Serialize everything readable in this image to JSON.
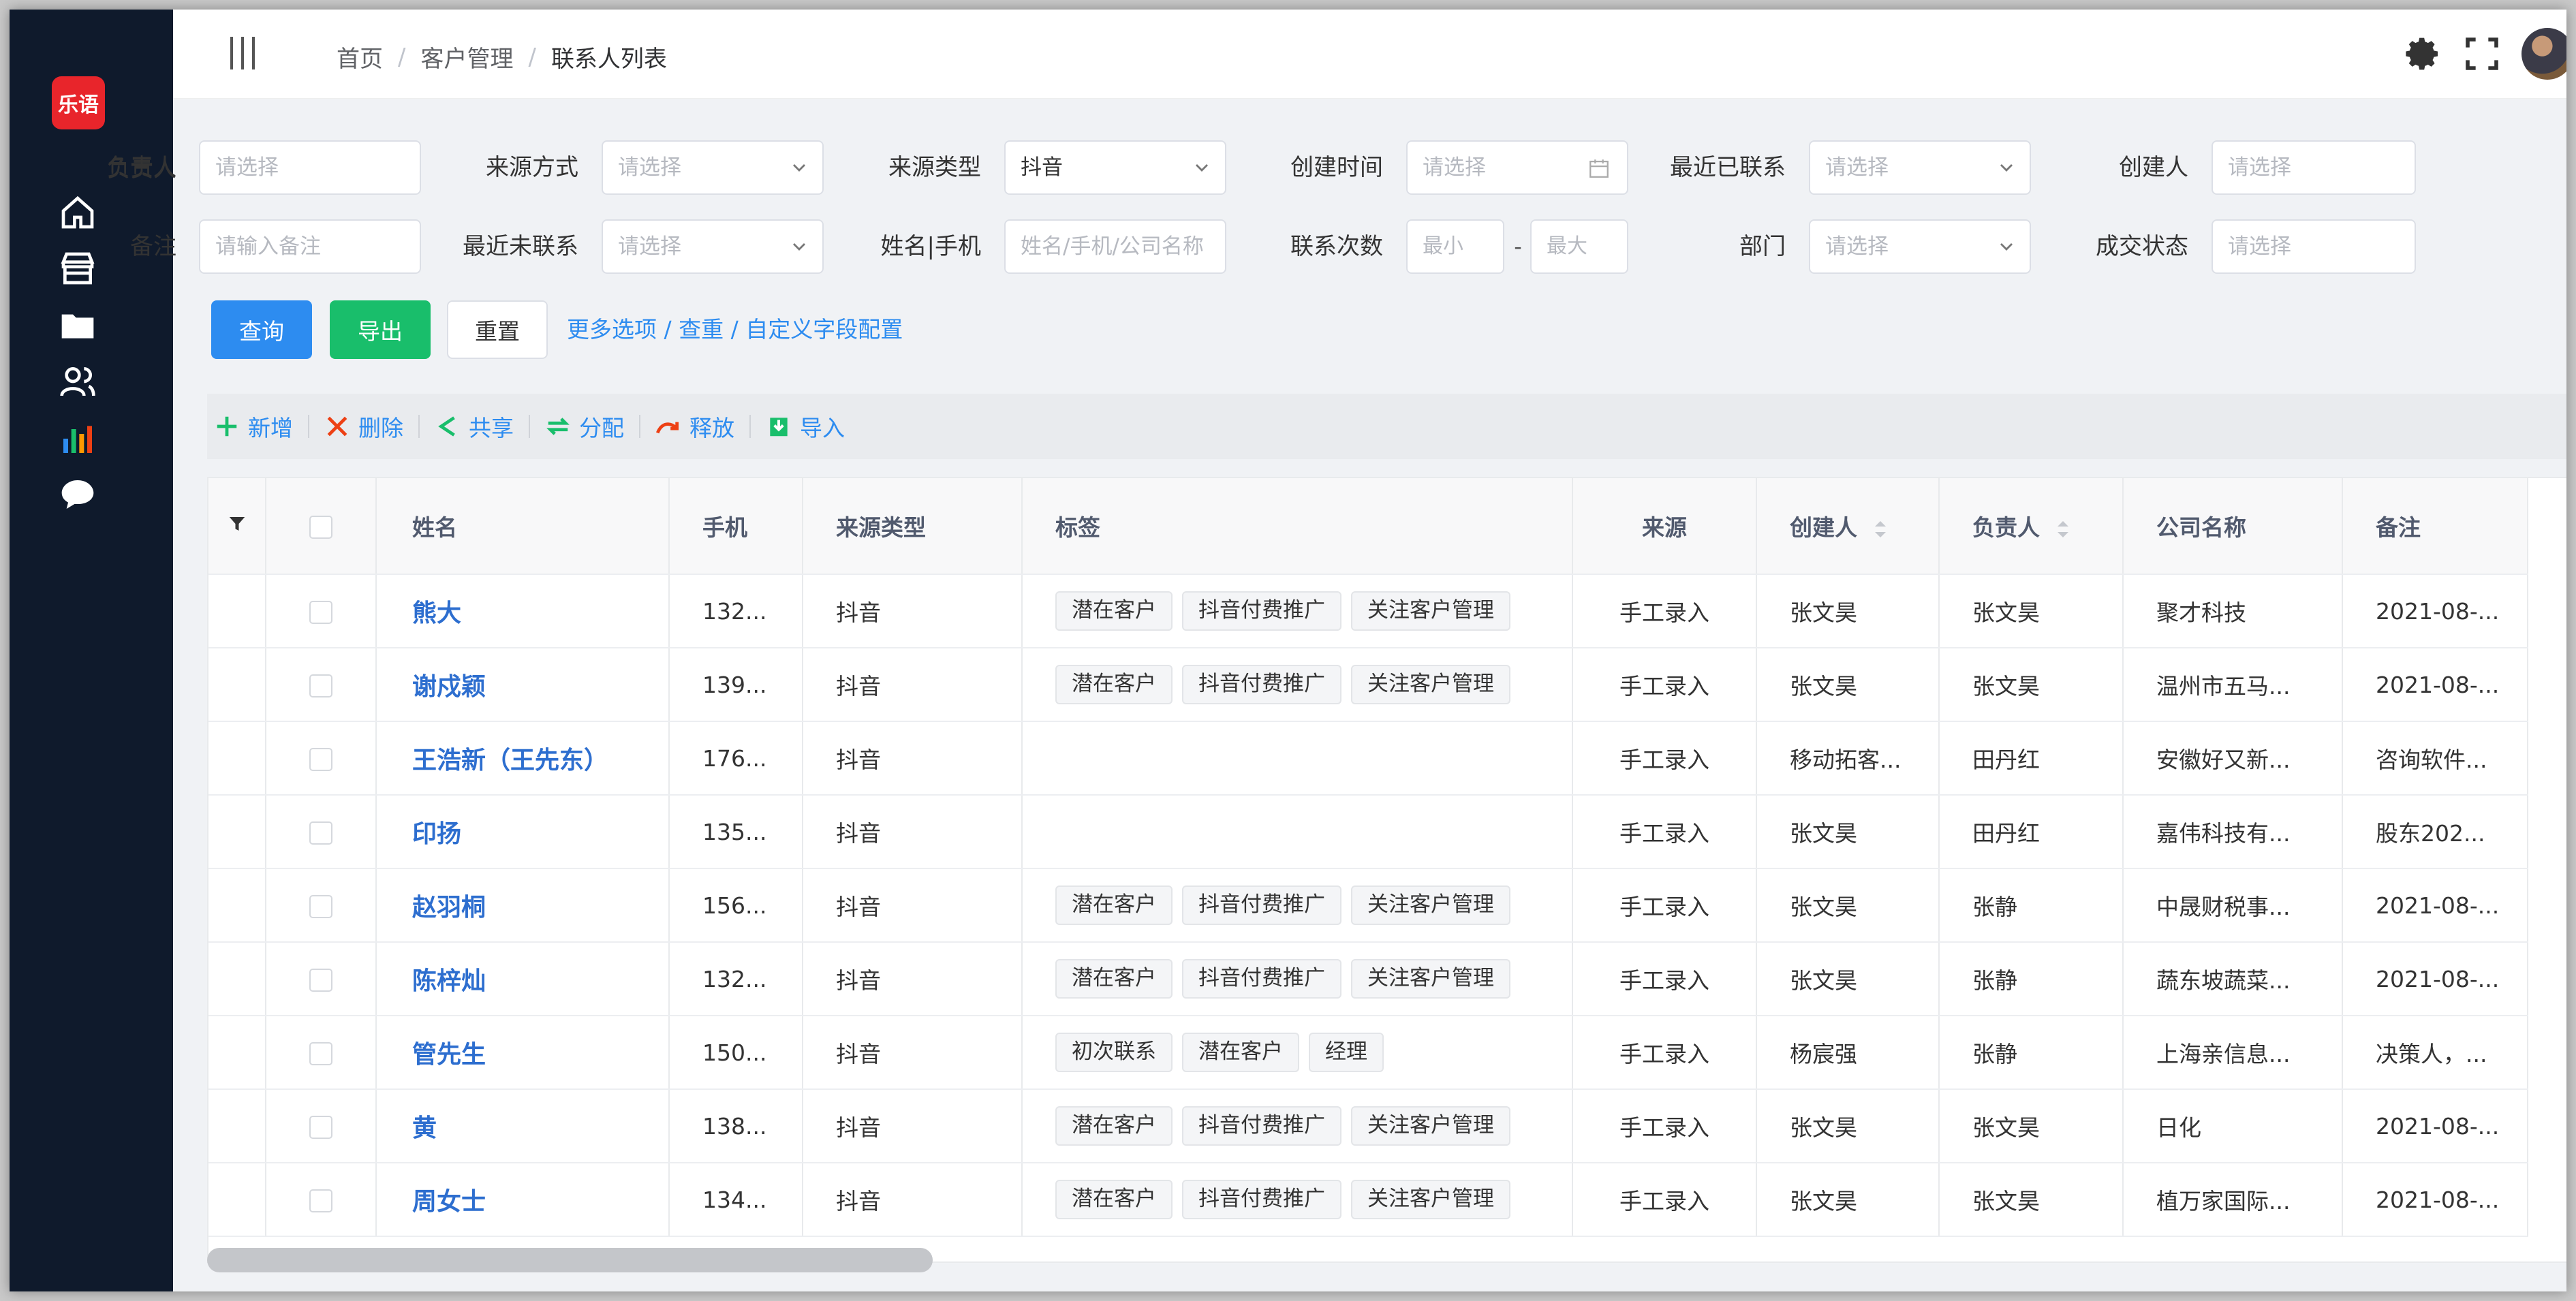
{
  "sidebar": {
    "logo_text": "乐语",
    "icons": [
      "home-icon",
      "store-icon",
      "folder-icon",
      "users-icon",
      "bar-chart-icon",
      "chat-icon"
    ]
  },
  "header": {
    "breadcrumb": [
      "首页",
      "客户管理",
      "联系人列表"
    ],
    "separator": "/"
  },
  "filters": {
    "row1": [
      {
        "label": "负责人",
        "placeholder": "请选择",
        "type": "input"
      },
      {
        "label": "来源方式",
        "placeholder": "请选择",
        "type": "select"
      },
      {
        "label": "来源类型",
        "value": "抖音",
        "type": "select"
      },
      {
        "label": "创建时间",
        "placeholder": "请选择",
        "type": "date"
      },
      {
        "label": "最近已联系",
        "placeholder": "请选择",
        "type": "select"
      },
      {
        "label": "创建人",
        "placeholder": "请选择",
        "type": "input"
      }
    ],
    "row2": [
      {
        "label": "备注",
        "placeholder": "请输入备注",
        "type": "input"
      },
      {
        "label": "最近未联系",
        "placeholder": "请选择",
        "type": "select"
      },
      {
        "label": "姓名|手机",
        "placeholder": "姓名/手机/公司名称",
        "type": "input"
      },
      {
        "label": "联系次数",
        "min_placeholder": "最小",
        "max_placeholder": "最大",
        "dash": "-",
        "type": "range"
      },
      {
        "label": "部门",
        "placeholder": "请选择",
        "type": "select"
      },
      {
        "label": "成交状态",
        "placeholder": "请选择",
        "type": "input"
      }
    ]
  },
  "actions": {
    "query": "查询",
    "export": "导出",
    "reset": "重置",
    "more": "更多选项 / 查重 / 自定义字段配置"
  },
  "toolbar": {
    "add": "新增",
    "delete": "删除",
    "share": "共享",
    "assign": "分配",
    "release": "释放",
    "import": "导入"
  },
  "table": {
    "headers": {
      "name": "姓名",
      "phone": "手机",
      "source_type": "来源类型",
      "tags": "标签",
      "source": "来源",
      "creator": "创建人",
      "owner": "负责人",
      "company": "公司名称",
      "remark": "备注"
    },
    "rows": [
      {
        "name": "熊大",
        "phone": "132...",
        "source_type": "抖音",
        "tags": [
          "潜在客户",
          "抖音付费推广",
          "关注客户管理"
        ],
        "source": "手工录入",
        "creator": "张文昊",
        "owner": "张文昊",
        "company": "聚才科技",
        "remark": "2021-08-..."
      },
      {
        "name": "谢戍颖",
        "phone": "139...",
        "source_type": "抖音",
        "tags": [
          "潜在客户",
          "抖音付费推广",
          "关注客户管理"
        ],
        "source": "手工录入",
        "creator": "张文昊",
        "owner": "张文昊",
        "company": "温州市五马...",
        "remark": "2021-08-..."
      },
      {
        "name": "王浩新（王先东）",
        "phone": "176...",
        "source_type": "抖音",
        "tags": [],
        "source": "手工录入",
        "creator": "移动拓客...",
        "owner": "田丹红",
        "company": "安徽好又新...",
        "remark": "咨询软件..."
      },
      {
        "name": "印扬",
        "phone": "135...",
        "source_type": "抖音",
        "tags": [],
        "source": "手工录入",
        "creator": "张文昊",
        "owner": "田丹红",
        "company": "嘉伟科技有...",
        "remark": "股东202..."
      },
      {
        "name": "赵羽桐",
        "phone": "156...",
        "source_type": "抖音",
        "tags": [
          "潜在客户",
          "抖音付费推广",
          "关注客户管理"
        ],
        "source": "手工录入",
        "creator": "张文昊",
        "owner": "张静",
        "company": "中晟财税事...",
        "remark": "2021-08-..."
      },
      {
        "name": "陈梓灿",
        "phone": "132...",
        "source_type": "抖音",
        "tags": [
          "潜在客户",
          "抖音付费推广",
          "关注客户管理"
        ],
        "source": "手工录入",
        "creator": "张文昊",
        "owner": "张静",
        "company": "蔬东坡蔬菜...",
        "remark": "2021-08-..."
      },
      {
        "name": "管先生",
        "phone": "150...",
        "source_type": "抖音",
        "tags": [
          "初次联系",
          "潜在客户",
          "经理"
        ],
        "source": "手工录入",
        "creator": "杨宸强",
        "owner": "张静",
        "company": "上海亲信息...",
        "remark": "决策人，..."
      },
      {
        "name": "黄",
        "phone": "138...",
        "source_type": "抖音",
        "tags": [
          "潜在客户",
          "抖音付费推广",
          "关注客户管理"
        ],
        "source": "手工录入",
        "creator": "张文昊",
        "owner": "张文昊",
        "company": "日化",
        "remark": "2021-08-..."
      },
      {
        "name": "周女士",
        "phone": "134...",
        "source_type": "抖音",
        "tags": [
          "潜在客户",
          "抖音付费推广",
          "关注客户管理"
        ],
        "source": "手工录入",
        "creator": "张文昊",
        "owner": "张文昊",
        "company": "植万家国际...",
        "remark": "2021-08-..."
      }
    ]
  }
}
